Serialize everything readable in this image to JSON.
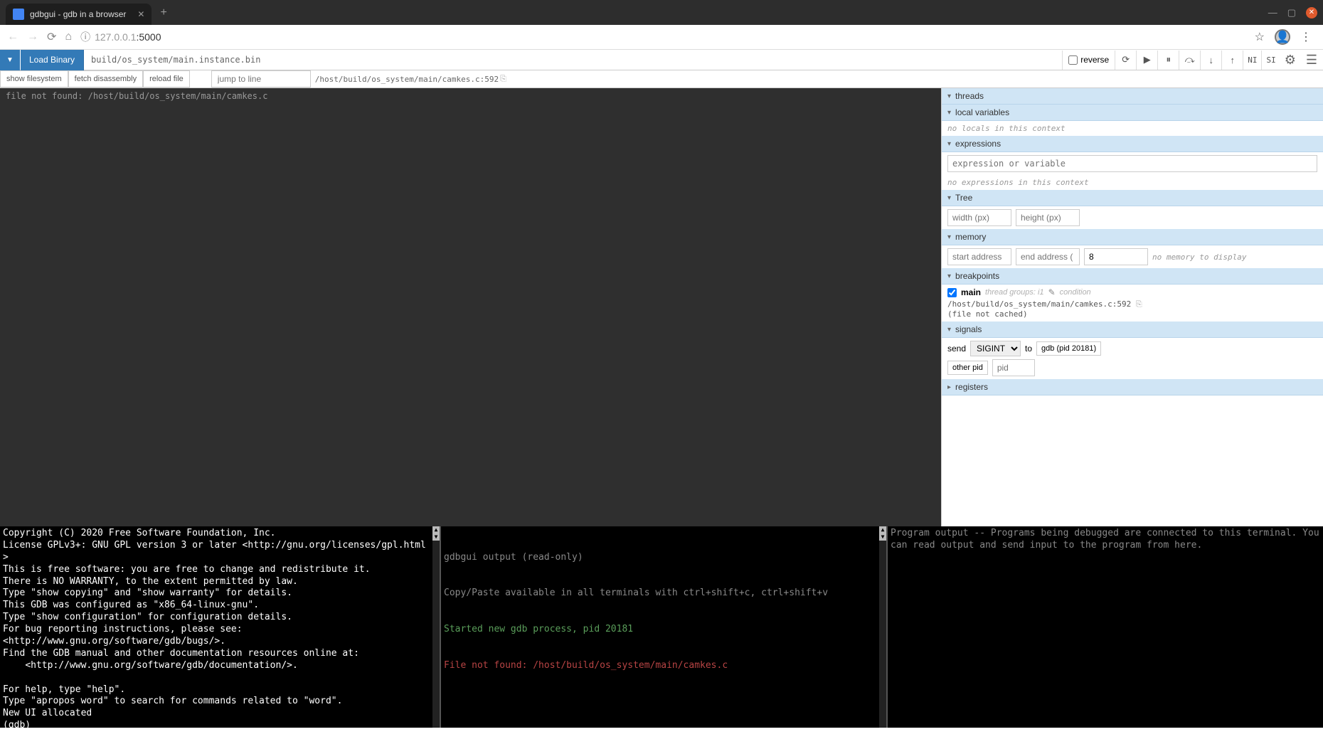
{
  "browser": {
    "tab_title": "gdbgui - gdb in a browser",
    "url_host": "127.0.0.1",
    "url_port": ":5000"
  },
  "toolbar": {
    "load_binary": "Load Binary",
    "binary_path": "build/os_system/main.instance.bin",
    "reverse_label": "reverse",
    "ni": "NI",
    "si": "SI"
  },
  "subtoolbar": {
    "show_fs": "show filesystem",
    "fetch_dis": "fetch disassembly",
    "reload": "reload file",
    "jump_placeholder": "jump to line",
    "file_path": "/host/build/os_system/main/camkes.c:592"
  },
  "code": {
    "error": "file not found: /host/build/os_system/main/camkes.c"
  },
  "panels": {
    "threads": "threads",
    "local_vars": "local variables",
    "no_locals": "no locals in this context",
    "expressions": "expressions",
    "expr_placeholder": "expression or variable",
    "no_expr": "no expressions in this context",
    "tree": "Tree",
    "width_ph": "width (px)",
    "height_ph": "height (px)",
    "memory": "memory",
    "start_addr_ph": "start address",
    "end_addr_ph": "end address (",
    "mem_bytes": "8",
    "no_mem": "no memory to display",
    "breakpoints": "breakpoints",
    "bp_main": "main",
    "bp_groups": "thread groups: i1",
    "bp_condition": "condition",
    "bp_file": "/host/build/os_system/main/camkes.c:592",
    "bp_cached": "(file not cached)",
    "signals": "signals",
    "send": "send",
    "signal_sel": "SIGINT",
    "to": "to",
    "gdb_pid": "gdb (pid 20181)",
    "other_pid": "other pid",
    "pid_ph": "pid",
    "registers": "registers"
  },
  "term1_lines": [
    "Copyright (C) 2020 Free Software Foundation, Inc.",
    "License GPLv3+: GNU GPL version 3 or later <http://gnu.org/licenses/gpl.html>",
    "This is free software: you are free to change and redistribute it.",
    "There is NO WARRANTY, to the extent permitted by law.",
    "Type \"show copying\" and \"show warranty\" for details.",
    "This GDB was configured as \"x86_64-linux-gnu\".",
    "Type \"show configuration\" for configuration details.",
    "For bug reporting instructions, please see:",
    "<http://www.gnu.org/software/gdb/bugs/>.",
    "Find the GDB manual and other documentation resources online at:",
    "    <http://www.gnu.org/software/gdb/documentation/>.",
    "",
    "For help, type \"help\".",
    "Type \"apropos word\" to search for commands related to \"word\".",
    "New UI allocated",
    "(gdb)"
  ],
  "term2": {
    "header1": "gdbgui output (read-only)",
    "header2": "Copy/Paste available in all terminals with ctrl+shift+c, ctrl+shift+v",
    "started": "Started new gdb process, pid 20181",
    "error": "File not found: /host/build/os_system/main/camkes.c"
  },
  "term3": {
    "line1": "Program output -- Programs being debugged are connected to this terminal. You can read output and send input to the program from here."
  }
}
